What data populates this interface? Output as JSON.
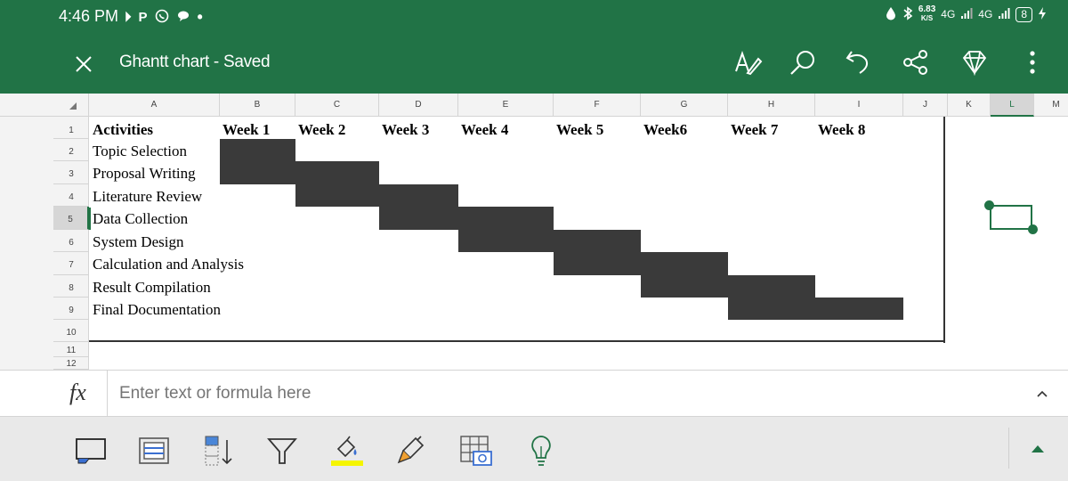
{
  "status_bar": {
    "time": "4:46 PM",
    "left_icons": [
      "forward-icon",
      "p-icon",
      "whatsapp-icon",
      "chat-icon",
      "dot-icon"
    ],
    "net_speed_value": "6.83",
    "net_speed_unit": "K/S",
    "network_1": "4G",
    "network_2": "4G",
    "battery": "8"
  },
  "title_bar": {
    "title": "Ghantt chart - Saved",
    "actions": [
      "draw-icon",
      "search-icon",
      "undo-icon",
      "share-icon",
      "premium-diamond-icon",
      "more-icon"
    ]
  },
  "columns": [
    "A",
    "B",
    "C",
    "D",
    "E",
    "F",
    "G",
    "H",
    "I",
    "J",
    "K",
    "L",
    "M"
  ],
  "selected_column": "L",
  "rows": [
    "1",
    "2",
    "3",
    "4",
    "5",
    "6",
    "7",
    "8",
    "9",
    "10",
    "11",
    "12"
  ],
  "selected_row": "5",
  "sheet": {
    "header_activity": "Activities",
    "weeks": [
      "Week 1",
      "Week 2",
      "Week 3",
      "Week 4",
      "Week 5",
      "Week6",
      "Week 7",
      "Week 8"
    ],
    "activities": [
      "Topic Selection",
      "Proposal Writing",
      "Literature Review",
      "Data Collection",
      "System Design",
      "Calculation and Analysis",
      "Result Compilation",
      "Final Documentation"
    ],
    "bar_spans": [
      {
        "activity": "Topic Selection",
        "weeks": [
          "Week 1"
        ]
      },
      {
        "activity": "Proposal Writing",
        "weeks": [
          "Week 1",
          "Week 2"
        ]
      },
      {
        "activity": "Literature Review",
        "weeks": [
          "Week 2",
          "Week 3"
        ]
      },
      {
        "activity": "Data Collection",
        "weeks": [
          "Week 3",
          "Week 4"
        ]
      },
      {
        "activity": "System Design",
        "weeks": [
          "Week 4",
          "Week 5"
        ]
      },
      {
        "activity": "Calculation and Analysis",
        "weeks": [
          "Week 5",
          "Week6"
        ]
      },
      {
        "activity": "Result Compilation",
        "weeks": [
          "Week6",
          "Week 7"
        ]
      },
      {
        "activity": "Final Documentation",
        "weeks": [
          "Week 7",
          "Week 8"
        ]
      }
    ]
  },
  "formula_bar": {
    "fx_label": "fx",
    "placeholder": "Enter text or formula here"
  },
  "bottom_toolbar": {
    "tools": [
      "cell-style-icon",
      "insert-table-icon",
      "sort-icon",
      "filter-icon",
      "fill-color-icon",
      "clear-format-icon",
      "insert-picture-icon",
      "ideas-lightbulb-icon"
    ],
    "fill_color": "#f5f500"
  },
  "colors": {
    "accent": "#217346",
    "bar": "#3a3a3a"
  }
}
